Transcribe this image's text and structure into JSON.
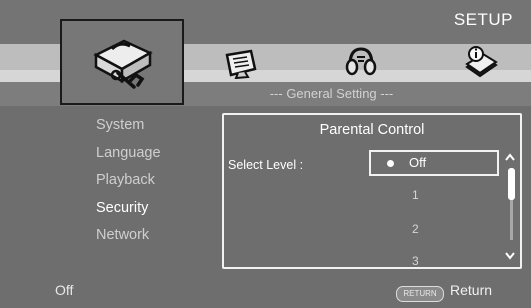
{
  "header": {
    "title": "SETUP"
  },
  "categories": [
    {
      "icon": "toolbox-icon",
      "selected": true
    },
    {
      "icon": "display-icon",
      "selected": false
    },
    {
      "icon": "audio-icon",
      "selected": false
    },
    {
      "icon": "info-book-icon",
      "selected": false
    }
  ],
  "section": {
    "title": "--- General Setting ---"
  },
  "sidebar": {
    "items": [
      {
        "label": "System"
      },
      {
        "label": "Language"
      },
      {
        "label": "Playback"
      },
      {
        "label": "Security",
        "active": true
      },
      {
        "label": "Network"
      }
    ]
  },
  "panel": {
    "title": "Parental Control",
    "select_label": "Select Level :",
    "selected_option": "Off",
    "options": [
      "1",
      "2",
      "3"
    ]
  },
  "footer": {
    "status": "Off",
    "return_key": "RETURN",
    "return_label": "Return"
  },
  "colors": {
    "background": "#6e6e6e",
    "highlight": "#ffffff",
    "dim_text": "#cfcfcf"
  }
}
